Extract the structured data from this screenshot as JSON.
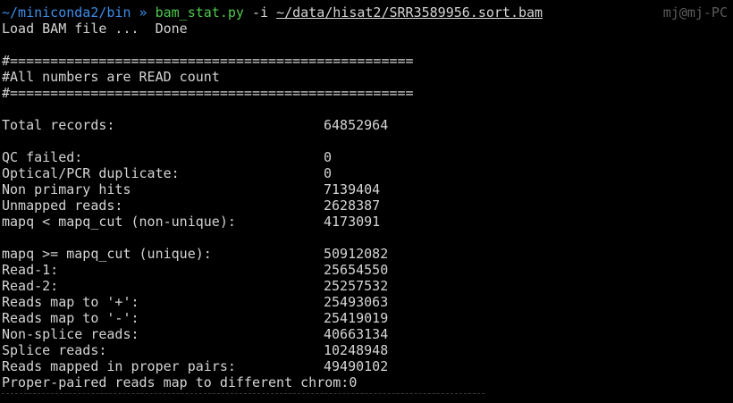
{
  "prompt": {
    "path": "~/miniconda2/bin",
    "separator": "»",
    "command": "bam_stat.py",
    "flag": "-i",
    "file": "~/data/hisat2/SRR3589956.sort.bam",
    "user_host": "mj@mj-PC"
  },
  "output": {
    "load_line": "Load BAM file ...  Done",
    "rule": "#==================================================",
    "header": "#All numbers are READ count",
    "total": {
      "label": "Total records:",
      "value": "64852964"
    },
    "group1": [
      {
        "label": "QC failed:",
        "value": "0"
      },
      {
        "label": "Optical/PCR duplicate:",
        "value": "0"
      },
      {
        "label": "Non primary hits",
        "value": "7139404"
      },
      {
        "label": "Unmapped reads:",
        "value": "2628387"
      },
      {
        "label": "mapq < mapq_cut (non-unique):",
        "value": "4173091"
      }
    ],
    "group2": [
      {
        "label": "mapq >= mapq_cut (unique):",
        "value": "50912082"
      },
      {
        "label": "Read-1:",
        "value": "25654550"
      },
      {
        "label": "Read-2:",
        "value": "25257532"
      },
      {
        "label": "Reads map to '+':",
        "value": "25493063"
      },
      {
        "label": "Reads map to '-':",
        "value": "25419019"
      },
      {
        "label": "Non-splice reads:",
        "value": "40663134"
      },
      {
        "label": "Splice reads:",
        "value": "10248948"
      },
      {
        "label": "Reads mapped in proper pairs:",
        "value": "49490102"
      }
    ],
    "last_line": "Proper-paired reads map to different chrom:0"
  }
}
